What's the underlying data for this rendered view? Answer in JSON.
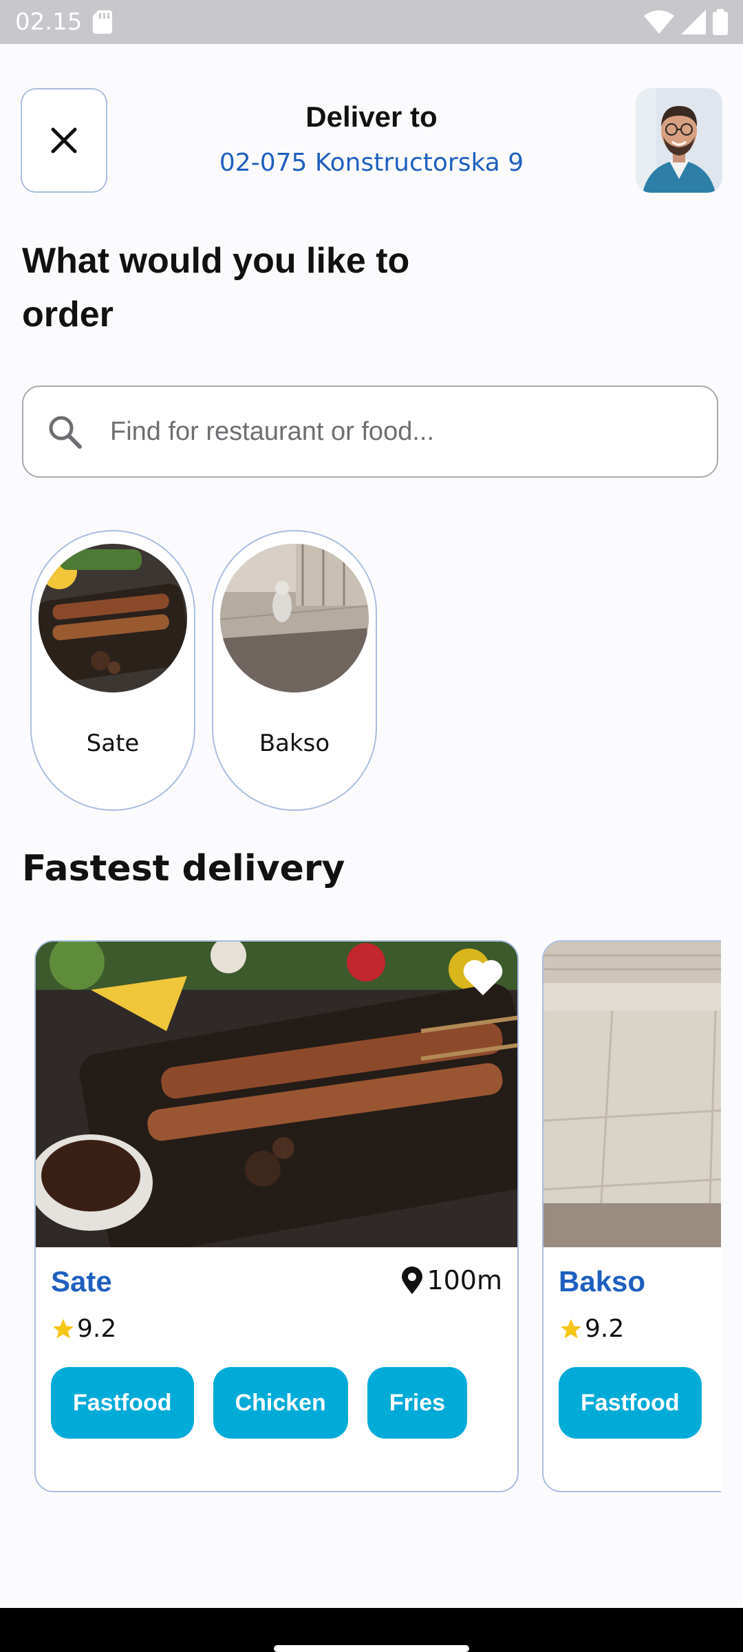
{
  "status_bar": {
    "time": "02.15",
    "icons": [
      "sd-card-icon",
      "wifi-icon",
      "signal-icon",
      "battery-icon"
    ]
  },
  "header": {
    "close_icon": "close-icon",
    "title": "Deliver to",
    "address": "02-075 Konstructorska 9"
  },
  "main": {
    "title": "What would you like to order",
    "search": {
      "placeholder": "Find for restaurant or food...",
      "value": ""
    },
    "categories": [
      {
        "label": "Sate"
      },
      {
        "label": "Bakso"
      }
    ],
    "section_title": "Fastest delivery",
    "restaurants": [
      {
        "name": "Sate",
        "distance": "100m",
        "rating": "9.2",
        "tags": [
          "Fastfood",
          "Chicken",
          "Fries"
        ],
        "favorite": true
      },
      {
        "name": "Bakso",
        "distance": "",
        "rating": "9.2",
        "tags": [
          "Fastfood"
        ],
        "favorite": false
      }
    ]
  },
  "colors": {
    "accent_blue": "#1e5fbf",
    "tag_bg": "#00abd8",
    "border": "#a9bde0",
    "star": "#f5c518"
  }
}
